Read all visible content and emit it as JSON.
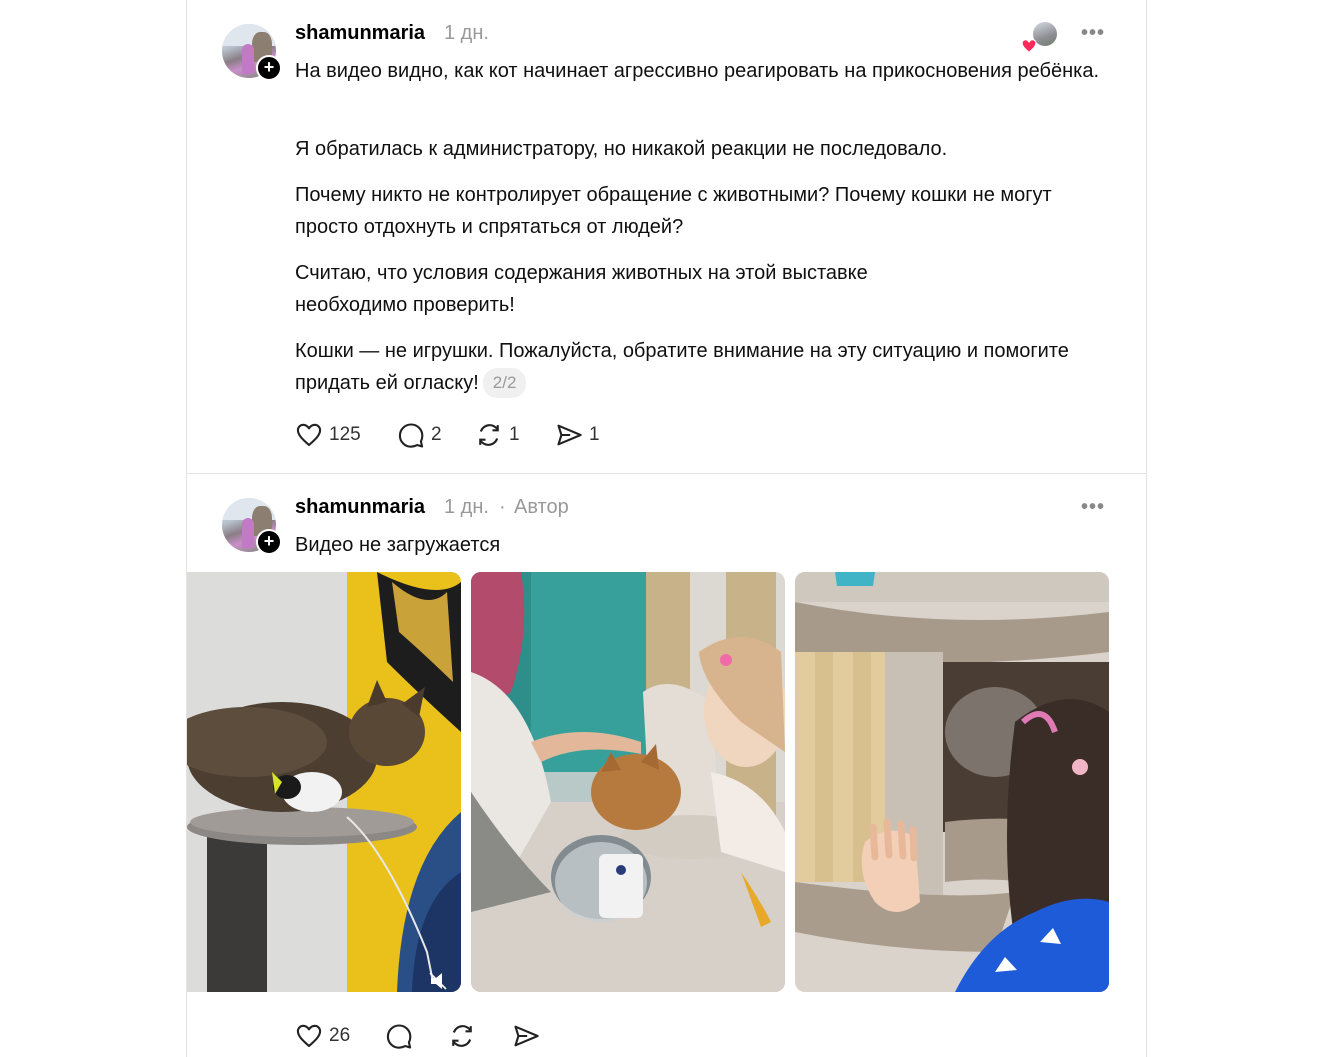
{
  "posts": [
    {
      "username": "shamunmaria",
      "time": "1 дн.",
      "paragraphs": [
        "На видео видно, как кот начинает агрессивно реагировать на прикосновения ребёнка.",
        "Я обратилась к администратору, но никакой реакции не последовало.",
        "Почему никто не контролирует обращение с животными? Почему кошки не могут просто отдохнуть и спрятаться от людей?",
        "Считаю, что условия содержания животных на этой выставке необходимо проверить!",
        "Кошки — не игрушки. Пожалуйста, обратите внимание на эту ситуацию и помогите придать ей огласку!"
      ],
      "pager": "2/2",
      "likes": "125",
      "comments": "2",
      "reposts": "1",
      "shares": "1",
      "liked_by_icon": "heart-icon"
    },
    {
      "username": "shamunmaria",
      "time": "1 дн.",
      "separator": "·",
      "role": "Автор",
      "text": "Видео не загружается",
      "likes": "26",
      "media": [
        "cat-on-tree-photo",
        "child-petting-cat-photo",
        "cat-in-cat-house-photo"
      ]
    }
  ],
  "icons": {
    "more": "more-icon",
    "follow": "plus-icon",
    "mute": "mute-icon"
  },
  "colors": {
    "heart": "#ff2a5b",
    "muted_text": "#999999",
    "divider": "#e3e3e3"
  }
}
